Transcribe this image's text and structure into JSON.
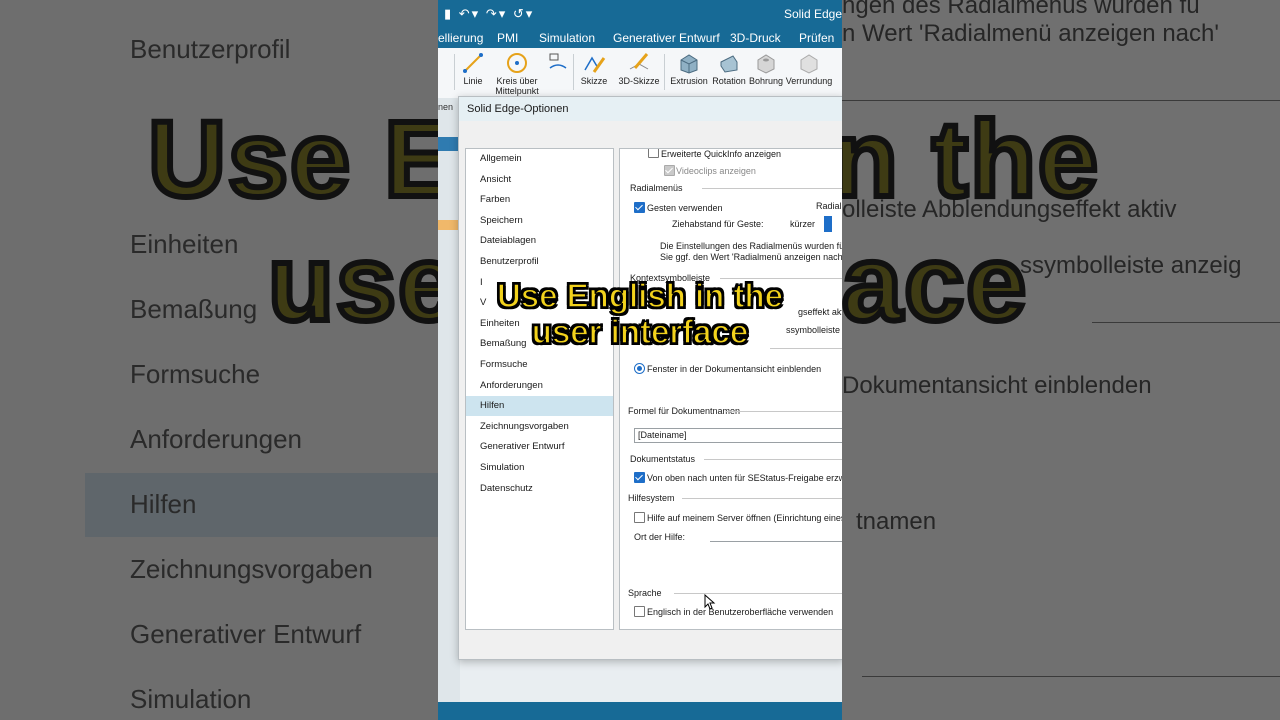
{
  "caption": {
    "line1": "Use English in the",
    "line2": "user interface"
  },
  "background": {
    "left_items": [
      "Benutzerprofil",
      "Einheiten",
      "Bemaßung",
      "Formsuche",
      "Anforderungen",
      "Hilfen",
      "Zeichnungsvorgaben",
      "Generativer Entwurf",
      "Simulation"
    ],
    "right_fragments": {
      "top1": "ngen des Radialmenüs wurden fü",
      "top2": "n Wert 'Radialmenü anzeigen nach'",
      "mid1": "olleiste Abblendungseffekt aktiv",
      "mid2": "ssymbolleiste anzeig",
      "mid3": "Dokumentansicht einblenden",
      "mid4": "tnamen"
    },
    "big_left": "Use E",
    "big_left2": "use",
    "big_right": "n the",
    "big_right2": "ace"
  },
  "app": {
    "title": "Solid Edge",
    "menu": [
      "ellierung",
      "PMI",
      "Simulation",
      "Generativer Entwurf",
      "3D-Druck",
      "Prüfen"
    ],
    "ribbon": [
      "Linie",
      "Kreis über Mittelpunkt",
      "Skizze",
      "3D-Skizze",
      "Extrusion",
      "Rotation",
      "Bohrung",
      "Verrundung"
    ],
    "left_cut": "nen"
  },
  "dialog": {
    "title": "Solid Edge-Optionen",
    "categories": [
      "Allgemein",
      "Ansicht",
      "Farben",
      "Speichern",
      "Dateiablagen",
      "Benutzerprofil",
      "I",
      "V",
      "Einheiten",
      "Bemaßung",
      "Formsuche",
      "Anforderungen",
      "Hilfen",
      "Zeichnungsvorgaben",
      "Generativer Entwurf",
      "Simulation",
      "Datenschutz"
    ],
    "selected_category": "Hilfen",
    "panel": {
      "quickinfo": "Erweiterte QuickInfo anzeigen",
      "videoclips": "Videoclips anzeigen",
      "radial_section": "Radialmenüs",
      "gesten": "Gesten verwenden",
      "radial_right": "Radial",
      "ziehabstand": "Ziehabstand für Geste:",
      "kuerzer": "kürzer",
      "radial_note1": "Die Einstellungen des Radialmenüs wurden für",
      "radial_note2": "Sie ggf. den Wert 'Radialmenü anzeigen nach'",
      "kontext_section": "Kontextsymbolleiste",
      "kontext1": "gseffekt aktiv",
      "kontext2": "ssymbolleiste anzeig",
      "fenster": "Fenster in der Dokumentansicht einblenden",
      "formel_section": "Formel für Dokumentnamen",
      "formel_value": "[Dateiname]",
      "status_section": "Dokumentstatus",
      "status_option": "Von oben nach unten für SEStatus-Freigabe erzwi",
      "hilfe_section": "Hilfesystem",
      "hilfe_server": "Hilfe auf meinem Server öffnen (Einrichtung eines H",
      "ort": "Ort der Hilfe:",
      "sprache_section": "Sprache",
      "englisch": "Englisch in der Benutzeroberfläche verwenden"
    }
  },
  "colors": {
    "titlebar": "#176a96",
    "caption": "#f2d21c",
    "selected": "#cde4ef",
    "check": "#1e6ec8"
  }
}
